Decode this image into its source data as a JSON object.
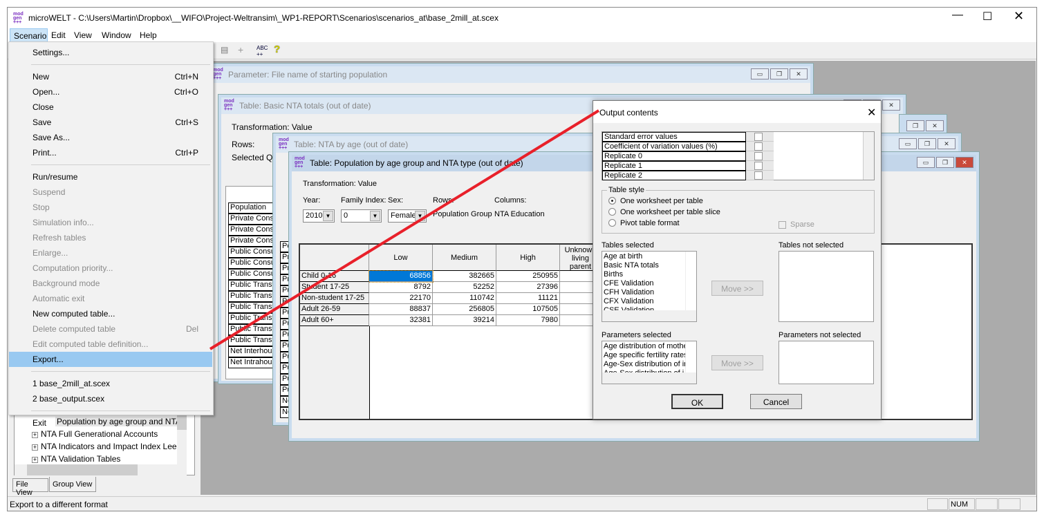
{
  "app": {
    "title": "microWELT - C:\\Users\\Martin\\Dropbox\\__WIFO\\Project-Weltransim\\_WP1-REPORT\\Scenarios\\scenarios_at\\base_2mill_at.scex",
    "logo_text": "mod gen +++"
  },
  "menubar": [
    "Scenario",
    "Edit",
    "View",
    "Window",
    "Help"
  ],
  "scenario_menu": [
    {
      "label": "Settings..."
    },
    {
      "sep": true
    },
    {
      "label": "New",
      "shortcut": "Ctrl+N"
    },
    {
      "label": "Open...",
      "shortcut": "Ctrl+O"
    },
    {
      "label": "Close"
    },
    {
      "label": "Save",
      "shortcut": "Ctrl+S"
    },
    {
      "label": "Save As..."
    },
    {
      "label": "Print...",
      "shortcut": "Ctrl+P"
    },
    {
      "sep": true
    },
    {
      "label": "Run/resume"
    },
    {
      "label": "Suspend",
      "disabled": true
    },
    {
      "label": "Stop",
      "disabled": true
    },
    {
      "label": "Simulation info...",
      "disabled": true
    },
    {
      "label": "Refresh tables",
      "disabled": true
    },
    {
      "label": "Enlarge...",
      "disabled": true
    },
    {
      "label": "Computation priority...",
      "disabled": true
    },
    {
      "label": "Background mode",
      "disabled": true
    },
    {
      "label": "Automatic exit",
      "disabled": true
    },
    {
      "label": "New computed table..."
    },
    {
      "label": "Delete computed table",
      "shortcut": "Del",
      "disabled": true
    },
    {
      "label": "Edit computed table definition...",
      "disabled": true
    },
    {
      "label": "Export...",
      "highlighted": true
    },
    {
      "sep": true
    },
    {
      "label": "1 base_2mill_at.scex"
    },
    {
      "label": "2 base_output.scex"
    },
    {
      "sep": true
    },
    {
      "label": "Exit"
    }
  ],
  "tree": {
    "items": [
      "Population by age group and NTA",
      "NTA Full Generational Accounts",
      "NTA Indicators and Impact Index Lee",
      "NTA Validation Tables"
    ],
    "tabs": [
      "File View",
      "Group View"
    ]
  },
  "windows": {
    "param": {
      "title": "Parameter: File name of starting population"
    },
    "basic": {
      "title": "Table: Basic NTA totals (out of date)",
      "transformation": "Transformation: Value",
      "rows": "Rows:",
      "selected": "Selected Qu",
      "rows_list": [
        "Population",
        "Private Consu",
        "Private Consu",
        "Private Consu",
        "Public Consu",
        "Public Consu",
        "Public Consu",
        "Public Transf",
        "Public Transf",
        "Public Transf",
        "Public Transf",
        "Public Transf",
        "Public Transf",
        "Net Interhous",
        "Net Intrahous"
      ]
    },
    "byage": {
      "title": "Table: NTA by age (out of date)",
      "rows_list": [
        "Po",
        "Pr",
        "Pr",
        "Pr",
        "Pu",
        "Pu",
        "Pu",
        "Pu",
        "Pu",
        "Pu",
        "Pu",
        "Pu",
        "Pu",
        "Pu",
        "Ne",
        "Ne"
      ]
    },
    "pop": {
      "title": "Table: Population by age group and NTA type (out of date)",
      "transformation": "Transformation: Value",
      "year_label": "Year:",
      "year": "2010",
      "family_label": "Family Index:",
      "family": "0",
      "sex_label": "Sex:",
      "sex": "Female",
      "rows_label": "Rows:",
      "rows_value": "Population Group",
      "cols_label": "Columns:",
      "cols_value": "NTA Education",
      "columns": [
        "Low",
        "Medium",
        "High",
        "Unknown living parent"
      ],
      "row_headers": [
        "Child 0-16",
        "Student 17-25",
        "Non-student 17-25",
        "Adult 26-59",
        "Adult 60+"
      ],
      "cells": [
        [
          "68856",
          "382665",
          "250955"
        ],
        [
          "8792",
          "52252",
          "27396"
        ],
        [
          "22170",
          "110742",
          "11121"
        ],
        [
          "88837",
          "256805",
          "107505"
        ],
        [
          "32381",
          "39214",
          "7980"
        ]
      ]
    }
  },
  "dialog": {
    "title": "Output contents",
    "options": [
      "Standard error values",
      "Coefficient of variation values (%)",
      "Replicate 0",
      "Replicate 1",
      "Replicate 2"
    ],
    "table_style_label": "Table style",
    "styles": [
      "One worksheet per table",
      "One worksheet per table slice",
      "Pivot table format"
    ],
    "selected_style": 0,
    "sparse": "Sparse",
    "tables_selected_label": "Tables selected",
    "tables_selected": [
      "Age at birth",
      "Basic NTA totals",
      "Births",
      "CFE Validation",
      "CFH Validation",
      "CFX Validation",
      "CSE Validation"
    ],
    "tables_not_selected_label": "Tables not selected",
    "params_selected_label": "Parameters selected",
    "params_selected": [
      "Age distribution of mothe",
      "Age specific fertility rates",
      "Age-Sex distribution of im",
      "Age-Sex distribution of i"
    ],
    "params_not_selected_label": "Parameters not selected",
    "move": "Move >>",
    "ok": "OK",
    "cancel": "Cancel"
  },
  "status": {
    "text": "Export to a different format",
    "num": "NUM"
  },
  "colors": {
    "annotation_line": "#e8202a",
    "selection": "#0078d7",
    "menu_highlight": "#99c9f1"
  }
}
